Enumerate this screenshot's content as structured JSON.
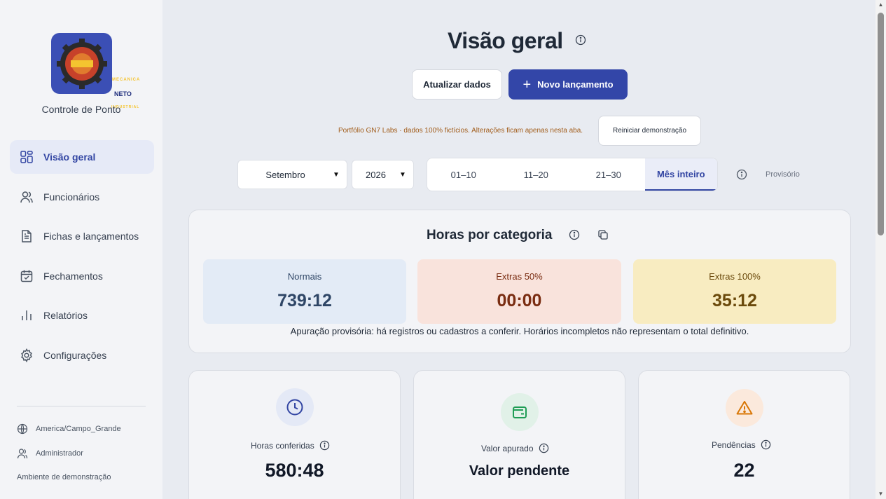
{
  "sidebar": {
    "logo": {
      "ring_text": "MECANICA",
      "center_text": "NETO",
      "bottom_text": "INDUSTRIAL"
    },
    "app_name": "Controle de Ponto",
    "items": [
      {
        "label": "Visão geral",
        "icon": "grid-icon",
        "active": true
      },
      {
        "label": "Funcionários",
        "icon": "users-icon",
        "active": false
      },
      {
        "label": "Fichas e lançamentos",
        "icon": "document-icon",
        "active": false
      },
      {
        "label": "Fechamentos",
        "icon": "calendar-check-icon",
        "active": false
      },
      {
        "label": "Relatórios",
        "icon": "bar-chart-icon",
        "active": false
      },
      {
        "label": "Configurações",
        "icon": "gear-icon",
        "active": false
      }
    ],
    "timezone": "America/Campo_Grande",
    "role": "Administrador",
    "environment": "Ambiente de demonstração"
  },
  "header": {
    "title": "Visão geral",
    "refresh_label": "Atualizar dados",
    "new_entry_label": "Novo lançamento",
    "demo_note": "Portfólio GN7 Labs · dados 100% fictícios. Alterações ficam apenas nesta aba.",
    "reset_label": "Reiniciar demonstração"
  },
  "filters": {
    "month": "Setembro",
    "year": "2026",
    "periods": [
      "01–10",
      "11–20",
      "21–30",
      "Mês inteiro"
    ],
    "active_period": "Mês inteiro",
    "status": "Provisório"
  },
  "hours": {
    "title": "Horas por categoria",
    "tiles": [
      {
        "label": "Normais",
        "value": "739:12",
        "bg": "#e3ebf6",
        "fg": "#2f4666",
        "lbl_fg": "#2f4666"
      },
      {
        "label": "Extras 50%",
        "value": "00:00",
        "bg": "#f9e3dc",
        "fg": "#7a2d12",
        "lbl_fg": "#7a2d12"
      },
      {
        "label": "Extras 100%",
        "value": "35:12",
        "bg": "#f8ecc1",
        "fg": "#6b4a0c",
        "lbl_fg": "#6b4a0c"
      }
    ],
    "note": "Apuração provisória: há registros ou cadastros a conferir. Horários incompletos não representam o total definitivo."
  },
  "stats": [
    {
      "label": "Horas conferidas",
      "value": "580:48",
      "icon": "clock-icon",
      "color": "#3346a3",
      "icon_bg": "#e4e9f6"
    },
    {
      "label": "Valor apurado",
      "value": "Valor pendente",
      "icon": "wallet-icon",
      "color": "#1f9d55",
      "icon_bg": "#e1f1e8"
    },
    {
      "label": "Pendências",
      "value": "22",
      "icon": "warning-icon",
      "color": "#d97706",
      "icon_bg": "#fbe9dc"
    }
  ],
  "colors": {
    "primary": "#3346a8",
    "accent_text": "#a15c1a"
  }
}
